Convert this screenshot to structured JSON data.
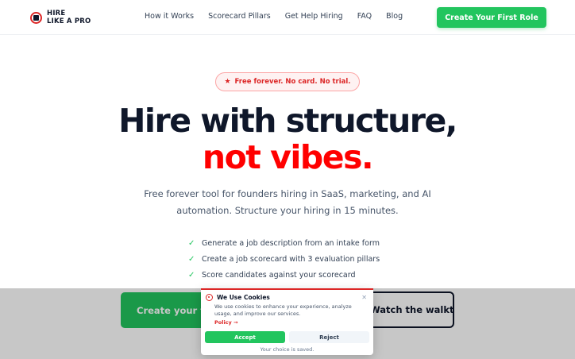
{
  "header": {
    "logo_line1": "HIRE",
    "logo_line2": "LIKE A PRO",
    "nav": [
      "How it Works",
      "Scorecard Pillars",
      "Get Help Hiring",
      "FAQ",
      "Blog"
    ],
    "cta_label": "Create Your First Role"
  },
  "hero": {
    "badge_icon": "star-icon",
    "badge_text": "Free forever. No card. No trial.",
    "title_line1": "Hire with structure,",
    "title_line2": "not vibes.",
    "subtitle": "Free forever tool for founders hiring in SaaS, marketing, and AI automation. Structure your hiring in 15 minutes.",
    "checks": [
      "Generate a job description from an intake form",
      "Create a job scorecard with 3 evaluation pillars",
      "Score candidates against your scorecard"
    ],
    "primary_button": "Create your first role",
    "secondary_button": "Watch the walkthrough"
  },
  "cookie": {
    "title": "We Use Cookies",
    "text": "We use cookies to enhance your experience, analyze usage, and improve our services.",
    "policy_link": "Policy →",
    "accept": "Accept",
    "reject": "Reject",
    "saved": "Your choice is saved."
  },
  "colors": {
    "accent_green": "#22c55e",
    "accent_red": "#ff0000",
    "brand_red": "#dc2626",
    "text_dark": "#0f172a"
  }
}
